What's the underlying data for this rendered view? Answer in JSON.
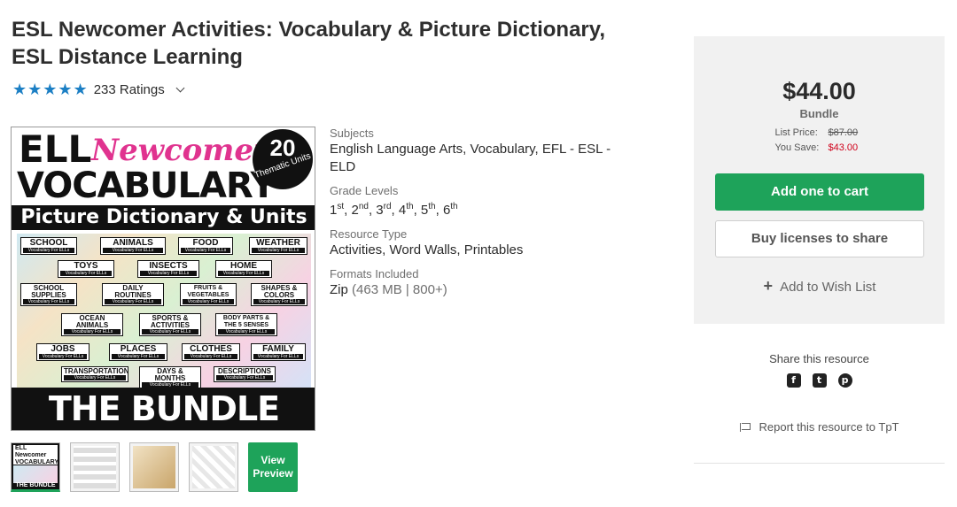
{
  "product": {
    "title_line1": "ESL Newcomer Activities: Vocabulary & Picture Dictionary,",
    "title_line2": "ESL Distance Learning",
    "rating_stars": "★★★★★",
    "rating_count": "233 Ratings"
  },
  "cover": {
    "ell": "ELL",
    "newcomer": "Newcomer",
    "vocabulary": "VOCABULARY",
    "badge_num": "20",
    "badge_text": "Thematic Units",
    "band": "Picture Dictionary & Units",
    "bottom": "THE BUNDLE",
    "sub": "Vocabulary For ELLs",
    "tiles": [
      "SCHOOL",
      "ANIMALS",
      "FOOD",
      "WEATHER",
      "TOYS",
      "INSECTS",
      "HOME",
      "SCHOOL SUPPLIES",
      "DAILY ROUTINES",
      "FRUITS & VEGETABLES",
      "SHAPES & COLORS",
      "OCEAN ANIMALS",
      "SPORTS & ACTIVITIES",
      "BODY PARTS & THE 5 SENSES",
      "JOBS",
      "PLACES",
      "CLOTHES",
      "FAMILY",
      "TRANSPORTATION",
      "DAYS & MONTHS",
      "DESCRIPTIONS"
    ]
  },
  "thumbs": {
    "mini_a": "ELL Newcomer VOCABULARY",
    "mini_c": "THE BUNDLE",
    "view_preview": "View Preview"
  },
  "details": {
    "subjects_label": "Subjects",
    "subjects_value": "English Language Arts, Vocabulary, EFL - ESL - ELD",
    "grades_label": "Grade Levels",
    "grades": [
      [
        "1",
        "st"
      ],
      [
        "2",
        "nd"
      ],
      [
        "3",
        "rd"
      ],
      [
        "4",
        "th"
      ],
      [
        "5",
        "th"
      ],
      [
        "6",
        "th"
      ]
    ],
    "resource_label": "Resource Type",
    "resource_value": "Activities, Word Walls, Printables",
    "formats_label": "Formats Included",
    "format_name": "Zip",
    "format_detail": "(463 MB | 800+)"
  },
  "buybox": {
    "price": "$44.00",
    "type": "Bundle",
    "list_price_label": "List Price:",
    "list_price": "$87.00",
    "you_save_label": "You Save:",
    "you_save": "$43.00",
    "cart_button": "Add one to cart",
    "license_button": "Buy licenses to share",
    "wish_label": "Add to Wish List",
    "wish_plus": "+"
  },
  "share": {
    "label": "Share this resource",
    "facebook": "f",
    "twitter": "t",
    "pinterest": "p"
  },
  "report": {
    "label": "Report this resource to TpT"
  },
  "colors": {
    "accent_green": "#1ea35a",
    "star_blue": "#1c7fc4",
    "save_red": "#d0021b"
  }
}
